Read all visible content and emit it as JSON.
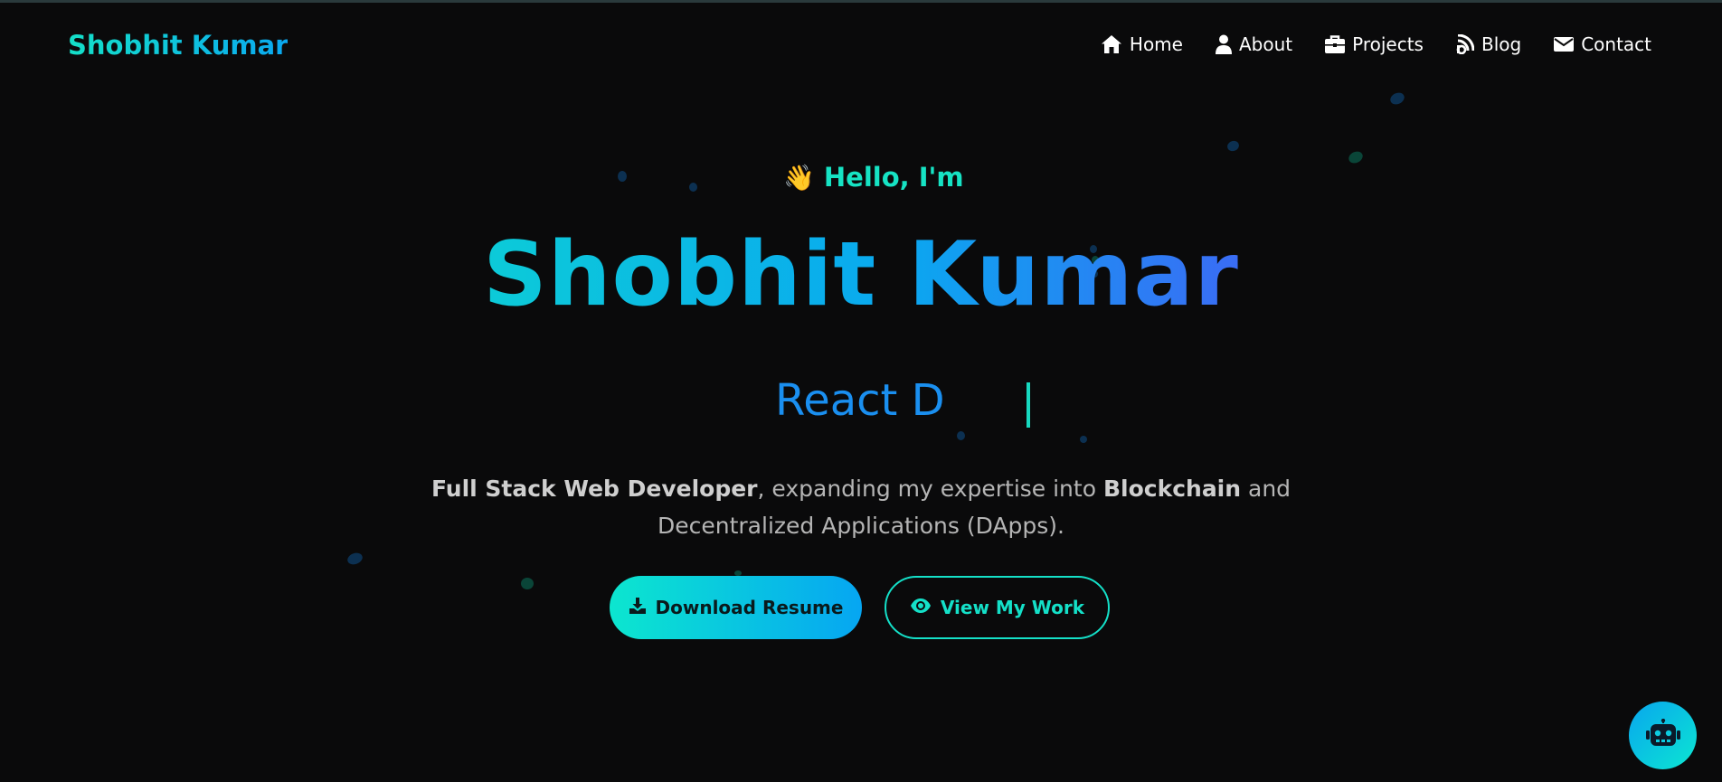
{
  "header": {
    "logo": "Shobhit Kumar",
    "nav": [
      {
        "label": "Home",
        "icon": "home-icon"
      },
      {
        "label": "About",
        "icon": "user-icon"
      },
      {
        "label": "Projects",
        "icon": "briefcase-icon"
      },
      {
        "label": "Blog",
        "icon": "blog-icon"
      },
      {
        "label": "Contact",
        "icon": "envelope-icon"
      }
    ]
  },
  "hero": {
    "greeting": "Hello, I'm",
    "wave_emoji": "👋",
    "name": "Shobhit Kumar",
    "typed_text": "React D",
    "description": {
      "part1": "Full Stack Web Developer",
      "part2": ", expanding my expertise into ",
      "part3": "Blockchain",
      "part4": " and",
      "part5": "Decentralized Applications (DApps)."
    },
    "buttons": {
      "download": "Download Resume",
      "view_work": "View My Work"
    }
  },
  "chatbot": {
    "icon": "robot-icon"
  },
  "colors": {
    "background": "#0a0a0b",
    "accent_teal": "#14e0c8",
    "accent_blue": "#0aa8f0"
  }
}
